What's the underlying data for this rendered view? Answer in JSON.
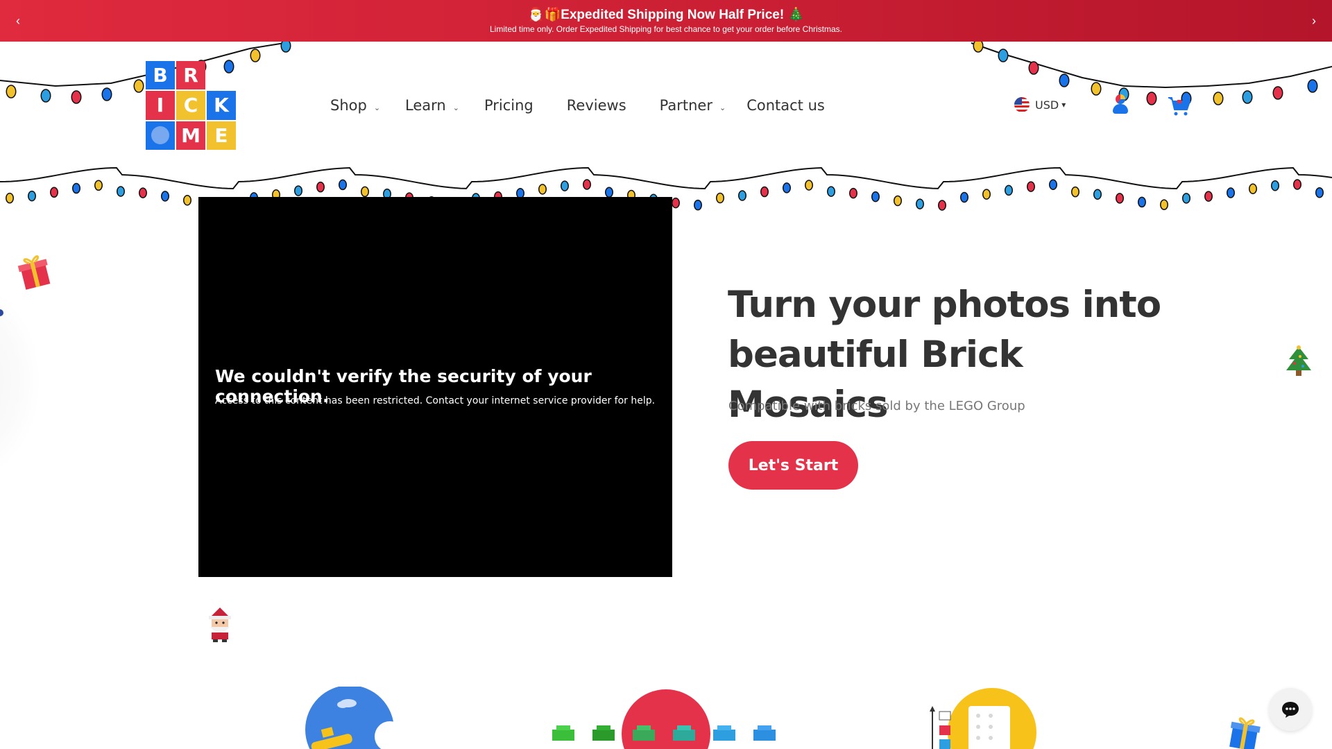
{
  "announcement": {
    "headline": "🎅🎁Expedited Shipping Now Half Price! 🎄",
    "subtext": "Limited time only. Order Expedited Shipping for best chance to get your order before Christmas.",
    "prev_label": "‹",
    "next_label": "›",
    "background": "#d42238"
  },
  "logo": {
    "letters": [
      "B",
      "R",
      "I",
      "C",
      "K",
      "",
      "M",
      "E"
    ],
    "colors": [
      "#1a73e8",
      "#e4324a",
      "#e4324a",
      "#f2c12e",
      "#1a73e8",
      "#1a73e8",
      "#e4324a",
      "#f2c12e"
    ]
  },
  "nav": {
    "items": [
      {
        "label": "Shop",
        "has_dropdown": true
      },
      {
        "label": "Learn",
        "has_dropdown": true
      },
      {
        "label": "Pricing",
        "has_dropdown": false
      },
      {
        "label": "Reviews",
        "has_dropdown": false
      },
      {
        "label": "Partner",
        "has_dropdown": true
      },
      {
        "label": "Contact us",
        "has_dropdown": false
      }
    ],
    "chevron": "⌄"
  },
  "header": {
    "currency": "USD",
    "currency_caret": "▾",
    "account_icon": "account-icon",
    "cart_icon": "cart-icon"
  },
  "video": {
    "error_title": "We couldn't verify the security of your connection.",
    "error_body": "Access to this content has been restricted. Contact your internet service provider for help."
  },
  "hero": {
    "title": "Turn your photos into beautiful Brick Mosaics",
    "subtitle": "Compatible with bricks sold by the LEGO Group",
    "cta_label": "Let's Start",
    "cta_color": "#e4324a"
  },
  "decor": {
    "icons": [
      "gift-icon",
      "christmas-tree-icon",
      "santa-icon",
      "gift-blue-icon"
    ]
  },
  "features": {
    "icons": [
      "rocket-moon-icon",
      "bricks-icon",
      "instructions-icon"
    ],
    "circle_colors": [
      "#3d82e0",
      "#e4324a",
      "#f7c21a"
    ]
  },
  "chat": {
    "icon": "chat-icon"
  },
  "lights": {
    "bulb_colors": [
      "#f2c12e",
      "#2d9fe0",
      "#e4324a",
      "#1a73e8"
    ]
  }
}
